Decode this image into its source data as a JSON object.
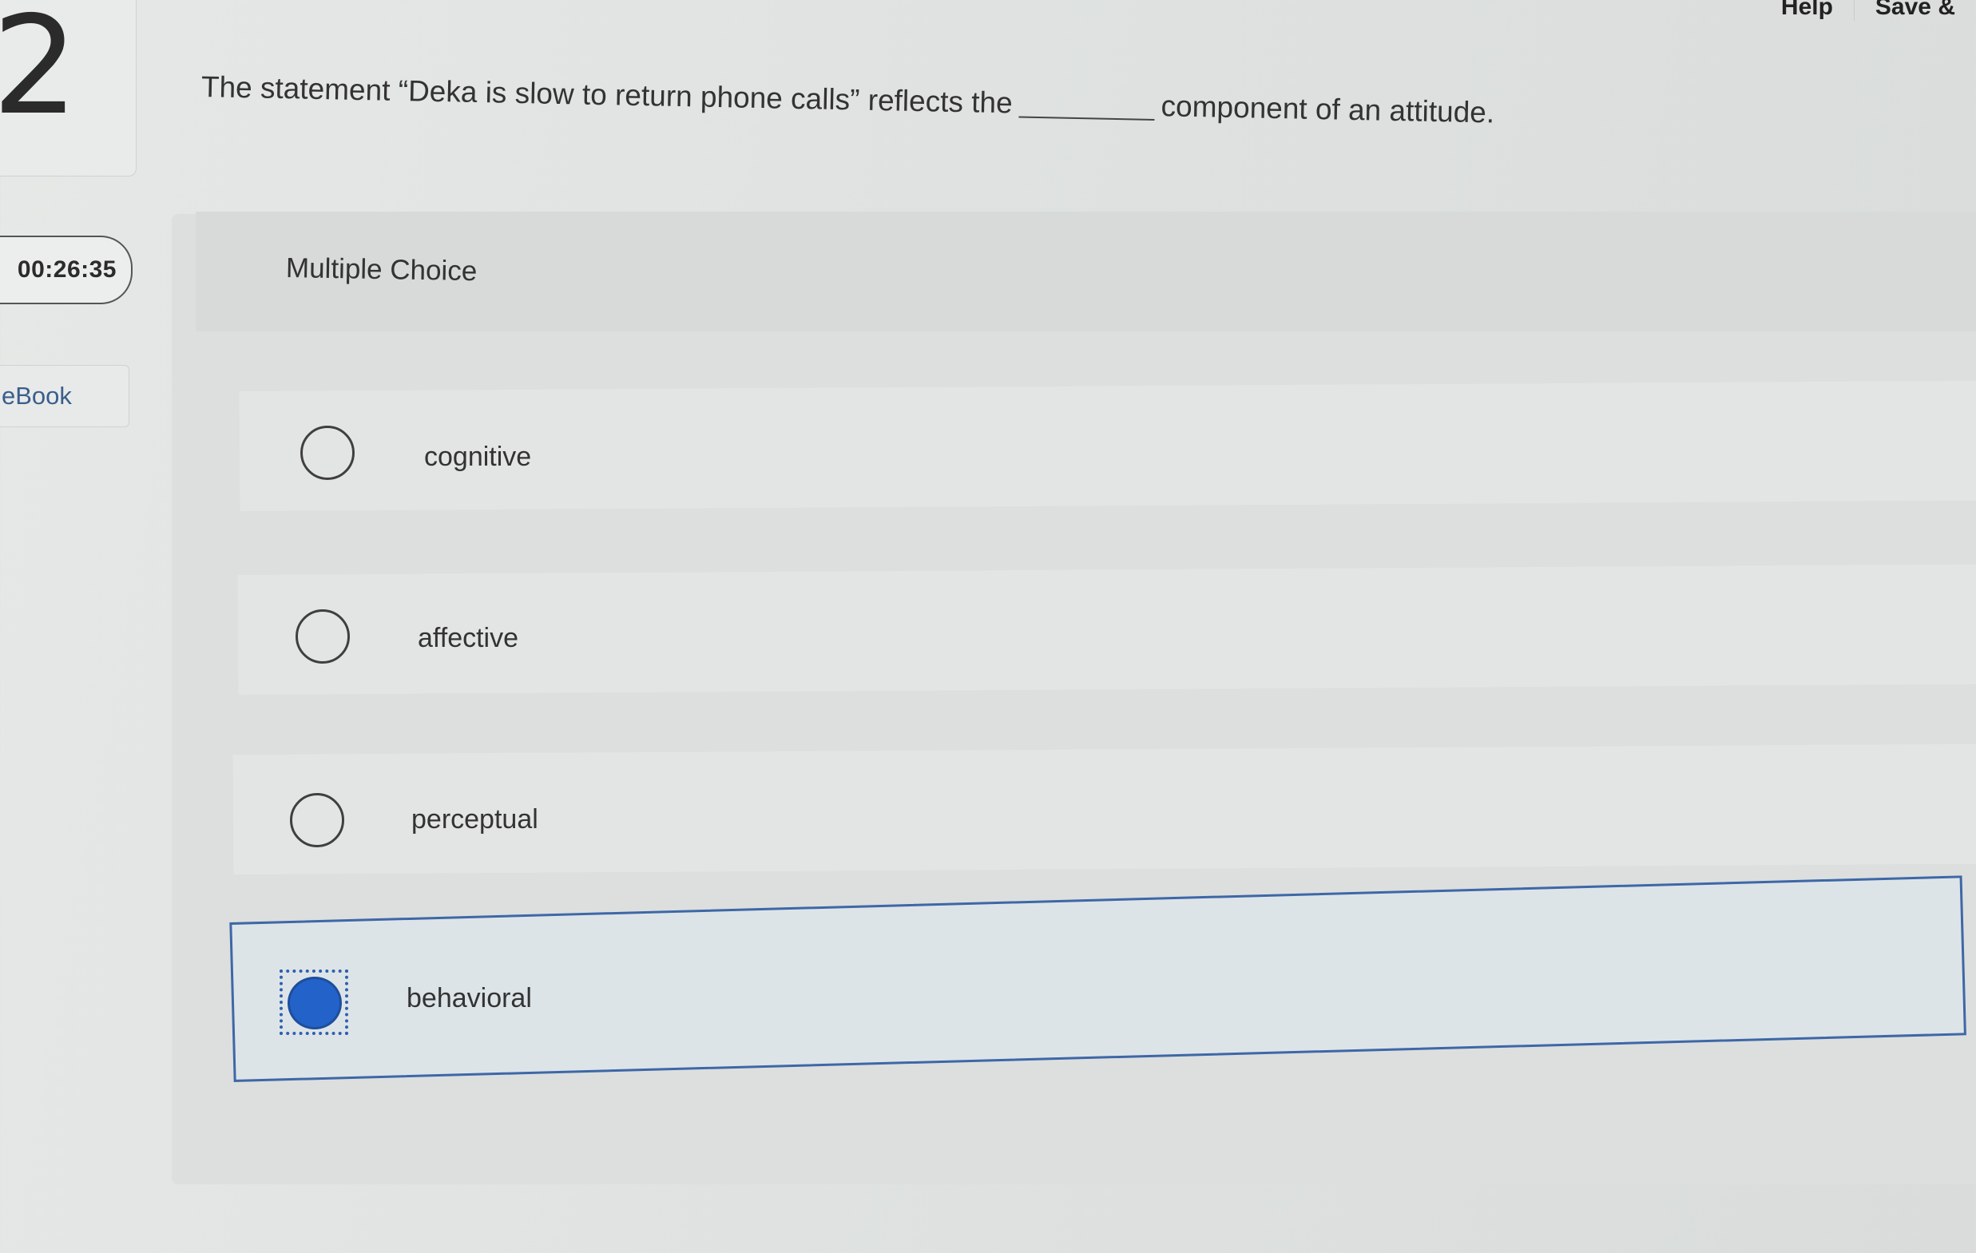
{
  "header": {
    "question_number": "2",
    "links": [
      "Help",
      "Save &"
    ]
  },
  "sidebar": {
    "timer": "00:26:35",
    "ebook_label": "eBook"
  },
  "question": {
    "text_before": "The statement “Deka is slow to return phone calls” reflects the",
    "text_after": "component of an attitude.",
    "type_label": "Multiple Choice",
    "options": [
      {
        "label": "cognitive",
        "selected": false
      },
      {
        "label": "affective",
        "selected": false
      },
      {
        "label": "perceptual",
        "selected": false
      },
      {
        "label": "behavioral",
        "selected": true
      }
    ]
  },
  "colors": {
    "selected_accent": "#2362c9",
    "selected_border": "#3e67a6",
    "ebook_link": "#3a5e8c"
  }
}
